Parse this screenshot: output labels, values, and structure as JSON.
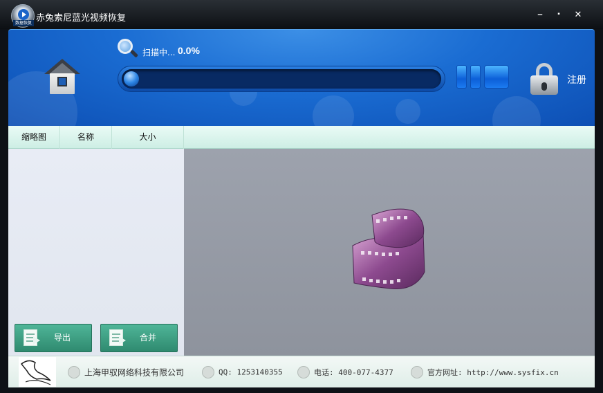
{
  "window": {
    "title": "赤兔索尼蓝光视频恢复",
    "logo_text": "数据恢复",
    "minimize": "–",
    "maximize": "▪",
    "close": "✕"
  },
  "header": {
    "status_text": "扫描中...",
    "progress_text": "0.0%",
    "progress_value": 0.0,
    "register_label": "注册",
    "icons": [
      "home-icon",
      "search-icon",
      "pause-icon",
      "stop-icon",
      "lock-icon"
    ]
  },
  "columns": [
    "缩略图",
    "名称",
    "大小"
  ],
  "actions": {
    "export_label": "导出",
    "merge_label": "合并"
  },
  "footer": {
    "company": "上海甲驭网络科技有限公司",
    "qq": "QQ: 1253140355",
    "phone": "电话: 400-077-4377",
    "website": "官方网址: http://www.sysfix.cn"
  },
  "colors": {
    "header_blue": "#1a6cd2",
    "button_green": "#3a9c80",
    "preview_gray": "#959aa5"
  }
}
